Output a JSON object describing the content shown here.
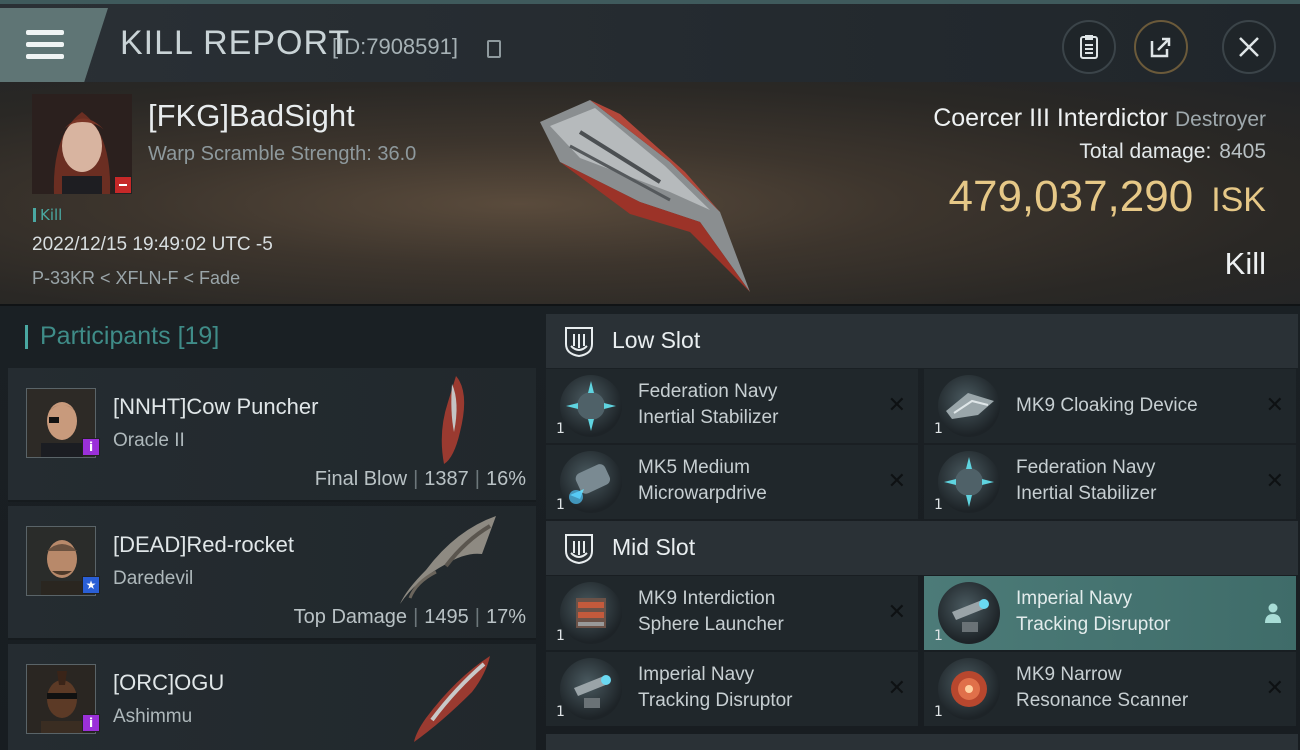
{
  "header": {
    "title": "KILL REPORT",
    "id_text": "[ID:7908591]"
  },
  "victim": {
    "name": "[FKG]BadSight",
    "warp_scramble": "Warp Scramble Strength: 36.0",
    "tag": "Kill",
    "datetime": "2022/12/15 19:49:02 UTC -5",
    "location": "P-33KR < XFLN-F < Fade",
    "ship_name": "Coercer III Interdictor",
    "ship_class": "Destroyer",
    "total_damage_label": "Total damage:",
    "total_damage_value": "8405",
    "isk_value": "479,037,290",
    "isk_unit": "ISK",
    "result": "Kill"
  },
  "participants": {
    "label": "Participants",
    "count": "[19]",
    "items": [
      {
        "name": "[NNHT]Cow Puncher",
        "ship": "Oracle II",
        "role": "Final Blow",
        "damage": "1387",
        "percent": "16%",
        "sec_color": "#9b30d9",
        "sec_symbol": "i"
      },
      {
        "name": "[DEAD]Red-rocket",
        "ship": "Daredevil",
        "role": "Top Damage",
        "damage": "1495",
        "percent": "17%",
        "sec_color": "#2a5fd6",
        "sec_symbol": "★"
      },
      {
        "name": "[ORC]OGU",
        "ship": "Ashimmu",
        "role": "",
        "damage": "",
        "percent": "",
        "sec_color": "#9b30d9",
        "sec_symbol": "i"
      }
    ]
  },
  "low_slot": {
    "label": "Low Slot",
    "modules": [
      {
        "name_line1": "Federation Navy",
        "name_line2": "Inertial Stabilizer",
        "qty": "1"
      },
      {
        "name_line1": "MK9 Cloaking Device",
        "name_line2": "",
        "qty": "1"
      },
      {
        "name_line1": "MK5 Medium",
        "name_line2": "Microwarpdrive",
        "qty": "1"
      },
      {
        "name_line1": "Federation Navy",
        "name_line2": "Inertial Stabilizer",
        "qty": "1"
      }
    ]
  },
  "mid_slot": {
    "label": "Mid Slot",
    "modules": [
      {
        "name_line1": "MK9 Interdiction",
        "name_line2": "Sphere Launcher",
        "qty": "1"
      },
      {
        "name_line1": "Imperial Navy",
        "name_line2": "Tracking Disruptor",
        "qty": "1"
      },
      {
        "name_line1": "Imperial Navy",
        "name_line2": "Tracking Disruptor",
        "qty": "1"
      },
      {
        "name_line1": "MK9 Narrow",
        "name_line2": "Resonance Scanner",
        "qty": "1"
      }
    ]
  },
  "colors": {
    "accent_teal": "#4aa8a2",
    "isk_gold": "#e6c887",
    "highlight": "#4c7b78"
  },
  "icons": {
    "menu": "hamburger-icon",
    "copy": "copy-icon",
    "clipboard": "clipboard-icon",
    "share": "share-icon",
    "close": "close-icon",
    "slot": "slot-shield-icon",
    "remove": "x-icon",
    "person": "person-icon"
  }
}
